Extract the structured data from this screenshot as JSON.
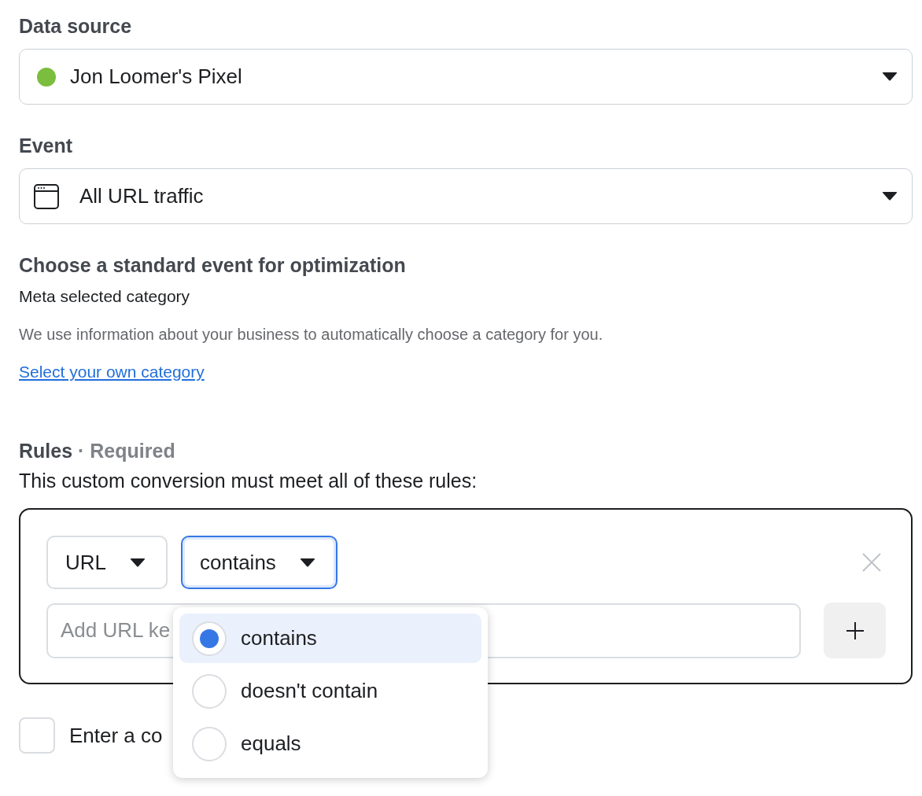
{
  "data_source": {
    "label": "Data source",
    "value": "Jon Loomer's Pixel"
  },
  "event": {
    "label": "Event",
    "value": "All URL traffic"
  },
  "optimization": {
    "heading": "Choose a standard event for optimization",
    "category": "Meta selected category",
    "description": "We use information about your business to automatically choose a category for you.",
    "link": "Select your own category"
  },
  "rules": {
    "label": "Rules",
    "required": "· Required",
    "description": "This custom conversion must meet all of these rules:",
    "field": "URL",
    "operator": "contains",
    "operator_open": true,
    "placeholder": "Add URL ke"
  },
  "operator_menu": [
    {
      "label": "contains",
      "selected": true
    },
    {
      "label": "doesn't contain",
      "selected": false
    },
    {
      "label": "equals",
      "selected": false
    }
  ],
  "checkbox": {
    "label": "Enter a co",
    "checked": false
  }
}
